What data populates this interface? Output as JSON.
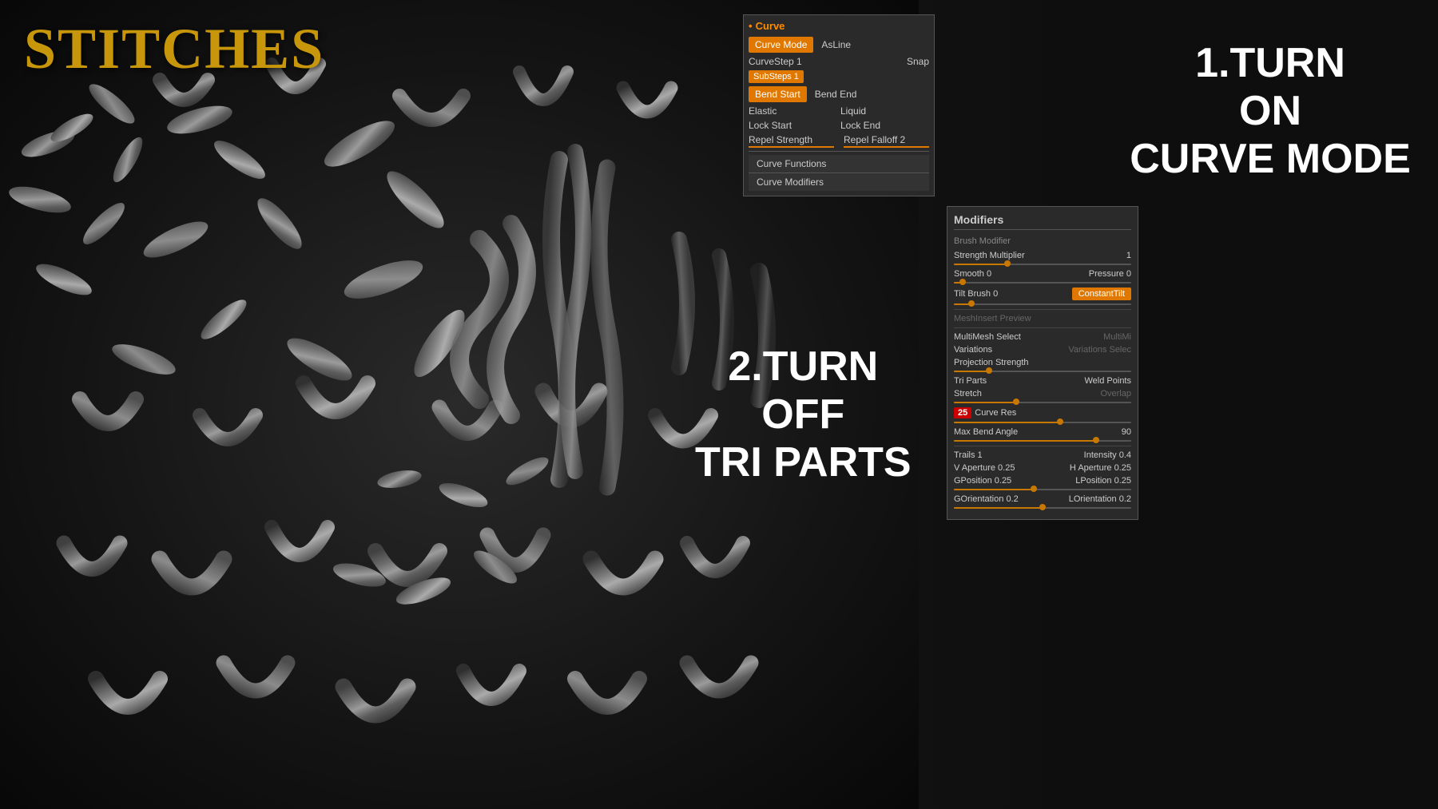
{
  "title": "STITCHES",
  "instruction1": {
    "line1": "1.TURN",
    "line2": "ON",
    "line3": "CURVE MODE"
  },
  "instruction2": {
    "line1": "2.TURN",
    "line2": "OFF",
    "line3": "TRI PARTS"
  },
  "curvePanel": {
    "title": "Curve",
    "curveModeLabel": "Curve Mode",
    "asLineLabel": "AsLine",
    "curveStepLabel": "CurveStep 1",
    "snapLabel": "Snap",
    "subStepsLabel": "SubSteps 1",
    "bendStartLabel": "Bend Start",
    "bendEndLabel": "Bend End",
    "elasticLabel": "Elastic",
    "liquidLabel": "Liquid",
    "lockStartLabel": "Lock Start",
    "lockEndLabel": "Lock End",
    "repelStrengthLabel": "Repel Strength",
    "repelFalloffLabel": "Repel Falloff 2",
    "curveFunctionsLabel": "Curve Functions",
    "curveModifiersLabel": "Curve Modifiers"
  },
  "modifiersPanel": {
    "title": "Modifiers",
    "brushModifierLabel": "Brush Modifier",
    "strengthMultiplierLabel": "Strength Multiplier",
    "strengthMultiplierValue": "1",
    "smoothLabel": "Smooth",
    "smoothValue": "0",
    "pressureLabel": "Pressure",
    "pressureValue": "0",
    "tiltBrushLabel": "Tilt Brush",
    "tiltBrushValue": "0",
    "constantTiltLabel": "ConstantTilt",
    "meshInsertPreviewLabel": "MeshInsert Preview",
    "multiMeshSelectLabel": "MultiMesh Select",
    "multiMiLabel": "MultiMi",
    "variationsLabel": "Variations",
    "variationsSelectLabel": "Variations Selec",
    "projectionStrengthLabel": "Projection Strength",
    "triPartsLabel": "Tri Parts",
    "weldPointsLabel": "Weld Points",
    "stretchLabel": "Stretch",
    "overlapLabel": "Overlap",
    "curveResLabel": "Curve Res",
    "curveResValue": "25",
    "maxBendAngleLabel": "Max Bend Angle",
    "maxBendAngleValue": "90",
    "trailsLabel": "Trails",
    "trailsValue": "1",
    "intensityLabel": "Intensity",
    "intensityValue": "0.4",
    "vApertureLabel": "V Aperture",
    "vApertureValue": "0.25",
    "hApertureLabel": "H Aperture",
    "hApertureValue": "0.25",
    "gPositionLabel": "GPosition",
    "gPositionValue": "0.25",
    "lPositionLabel": "LPosition",
    "lPositionValue": "0.25",
    "gOrientationLabel": "GOrientation",
    "gOrientationValue": "0.2",
    "lOrientationLabel": "LOrientation",
    "lOrientationValue": "0.2"
  },
  "colors": {
    "accent": "#e07800",
    "background": "#0e0e0e",
    "panelBg": "#2a2a2a",
    "titleGold": "#c8960a",
    "textColor": "#cccccc",
    "dimColor": "#666666"
  }
}
